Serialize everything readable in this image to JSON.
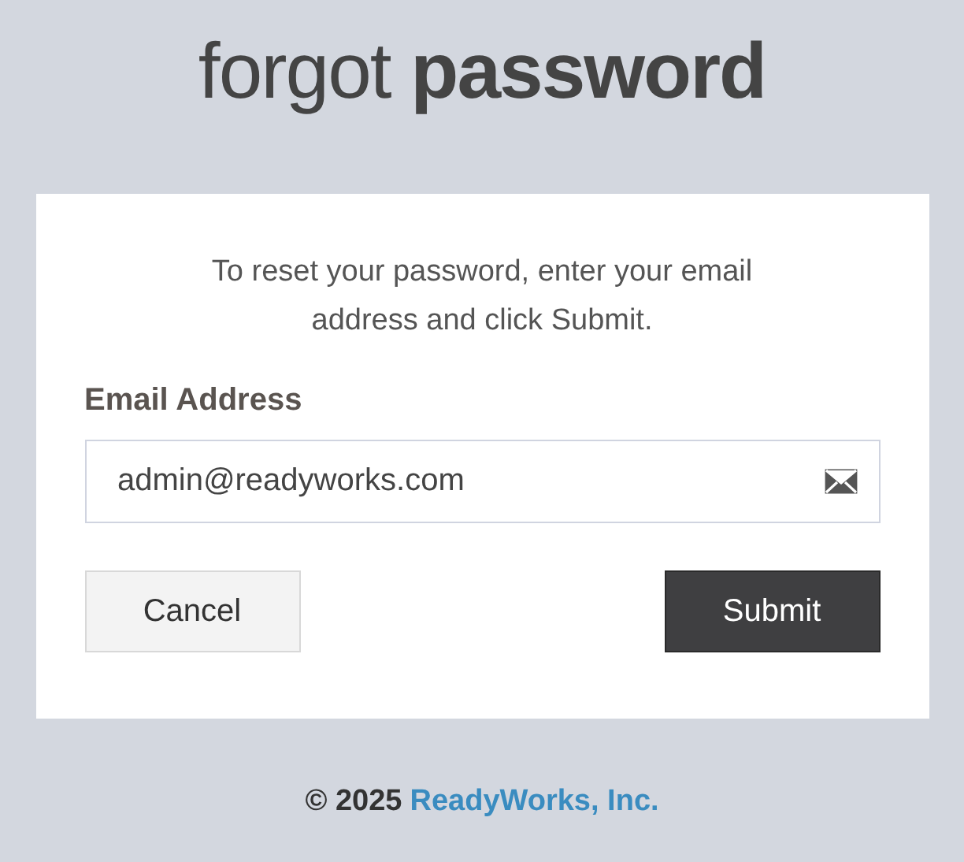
{
  "title": "forgot **password**",
  "card": {
    "instructions": "To reset your password, enter your email address and click Submit.",
    "email": {
      "label": "Email Address",
      "value": "admin@readyworks.com"
    },
    "buttons": [
      {
        "label": "Cancel",
        "kind": "secondary"
      },
      {
        "label": "Submit",
        "kind": "primary"
      }
    ]
  },
  "footer": {
    "copyright": "© 2025",
    "link": "ReadyWorks, Inc."
  }
}
